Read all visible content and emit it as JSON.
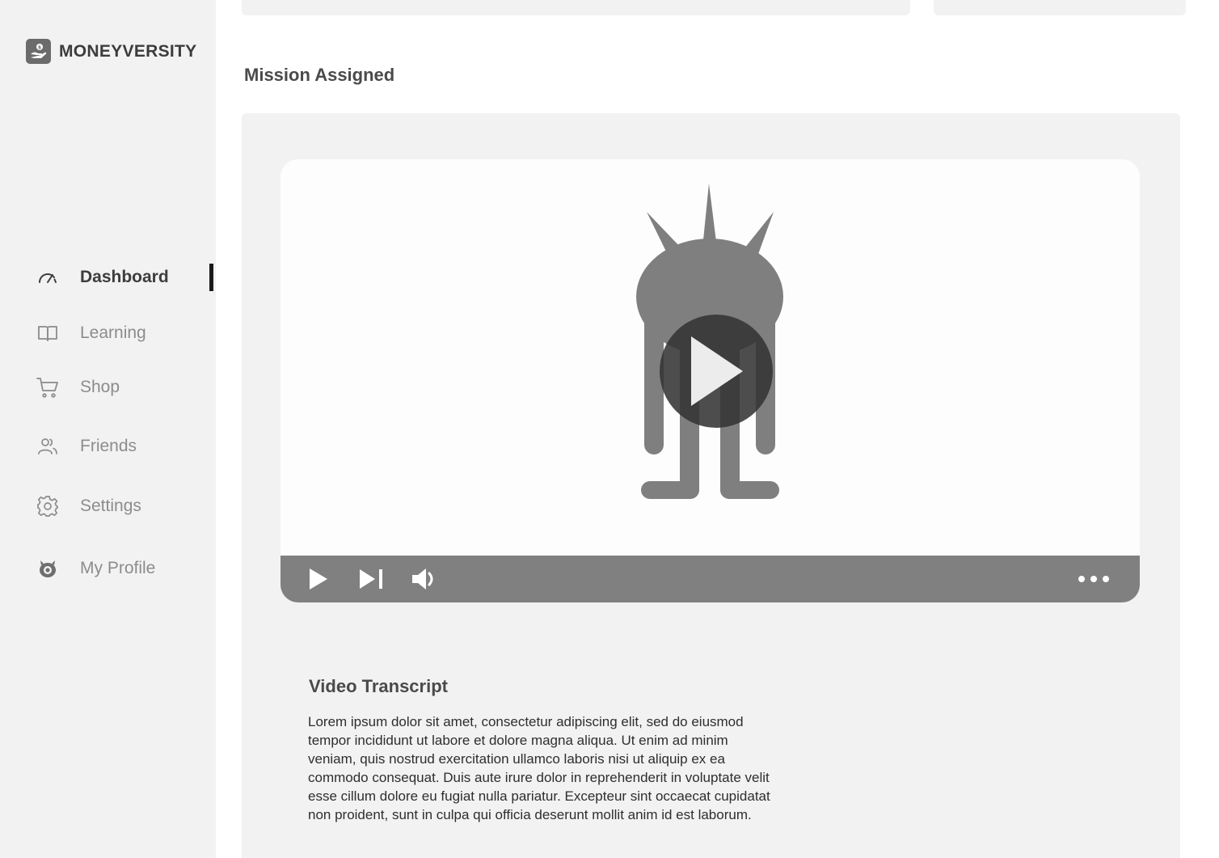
{
  "brand": {
    "name": "MONEYVERSITY"
  },
  "nav": {
    "dashboard": "Dashboard",
    "learning": "Learning",
    "shop": "Shop",
    "friends": "Friends",
    "settings": "Settings",
    "profile": "My Profile",
    "active": "Dashboard"
  },
  "mission": {
    "section_title": "Mission Assigned",
    "transcript_title": "Video Transcript",
    "transcript_text": "Lorem ipsum dolor sit amet, consectetur adipiscing elit, sed do eiusmod tempor incididunt ut labore et dolore magna aliqua. Ut enim ad minim veniam, quis nostrud exercitation ullamco laboris nisi ut aliquip ex ea commodo consequat. Duis aute irure dolor in reprehenderit in voluptate velit esse cillum dolore eu fugiat nulla pariatur. Excepteur sint occaecat cupidatat non proident, sunt in culpa qui officia deserunt mollit anim id est laborum."
  },
  "icons": {
    "logo": "hand-coin-icon",
    "dashboard": "gauge-icon",
    "learning": "book-icon",
    "shop": "cart-icon",
    "friends": "users-icon",
    "settings": "gear-icon",
    "profile": "monster-avatar-icon",
    "play": "play-icon",
    "next": "skip-next-icon",
    "volume": "volume-icon",
    "more": "more-icon"
  },
  "colors": {
    "sidebar_bg": "#f2f2f2",
    "controls_bg": "#808080",
    "active_indicator": "#1a1a1a",
    "monster": "#7f7f7f"
  }
}
